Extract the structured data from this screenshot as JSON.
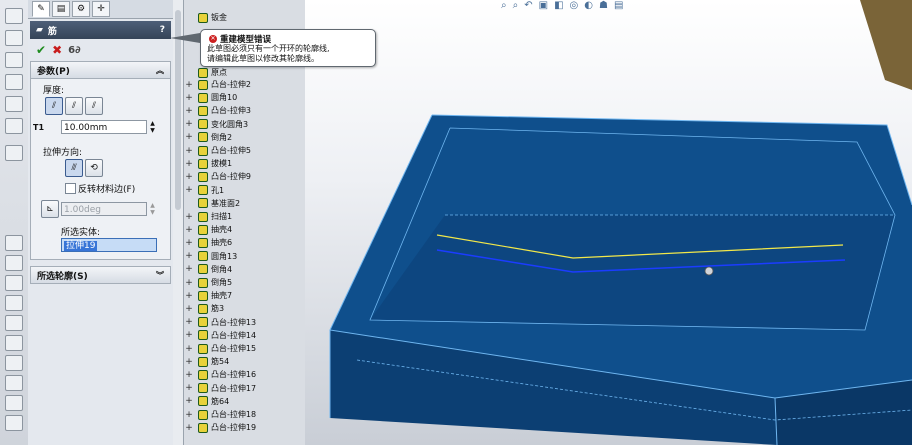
{
  "property_manager": {
    "title": "筋",
    "help": "?",
    "groups": {
      "params": {
        "label": "参数(P)"
      },
      "contours": {
        "label": "所选轮廓(S)"
      }
    },
    "thickness_label": "厚度:",
    "distance_value": "10.00mm",
    "extrude_dir_label": "拉伸方向:",
    "flip_material_label": "反转材料边(F)",
    "draft_value": "1.00deg",
    "selected_bodies_label": "所选实体:",
    "selected_body": "拉伸19",
    "distance_icon_label": "T1"
  },
  "error_tooltip": {
    "title": "重建模型错误",
    "line1": "此草图必须只有一个开环的轮廓线,",
    "line2": "请编辑此草图以修改其轮廓线。"
  },
  "tree": {
    "items": [
      {
        "label": "钣金",
        "expand": ""
      },
      {
        "label": "原点",
        "expand": ""
      },
      {
        "label": "凸台-拉伸2",
        "expand": "+"
      },
      {
        "label": "圆角10",
        "expand": "+"
      },
      {
        "label": "凸台-拉伸3",
        "expand": "+"
      },
      {
        "label": "变化圆角3",
        "expand": "+"
      },
      {
        "label": "倒角2",
        "expand": "+"
      },
      {
        "label": "凸台-拉伸5",
        "expand": "+"
      },
      {
        "label": "拔模1",
        "expand": "+"
      },
      {
        "label": "凸台-拉伸9",
        "expand": "+"
      },
      {
        "label": "孔1",
        "expand": "+"
      },
      {
        "label": "基准面2",
        "expand": ""
      },
      {
        "label": "扫描1",
        "expand": "+"
      },
      {
        "label": "抽壳4",
        "expand": "+"
      },
      {
        "label": "抽壳6",
        "expand": "+"
      },
      {
        "label": "圆角13",
        "expand": "+"
      },
      {
        "label": "倒角4",
        "expand": "+"
      },
      {
        "label": "倒角5",
        "expand": "+"
      },
      {
        "label": "抽壳7",
        "expand": "+"
      },
      {
        "label": "筋3",
        "expand": "+"
      },
      {
        "label": "凸台-拉伸13",
        "expand": "+"
      },
      {
        "label": "凸台-拉伸14",
        "expand": "+"
      },
      {
        "label": "凸台-拉伸15",
        "expand": "+"
      },
      {
        "label": "筋54",
        "expand": "+"
      },
      {
        "label": "凸台-拉伸16",
        "expand": "+"
      },
      {
        "label": "凸台-拉伸17",
        "expand": "+"
      },
      {
        "label": "筋64",
        "expand": "+"
      },
      {
        "label": "凸台-拉伸18",
        "expand": "+"
      },
      {
        "label": "凸台-拉伸19",
        "expand": "+"
      }
    ]
  },
  "colors": {
    "model": "#0f4f8c",
    "edges": "#6fb6f0",
    "sketch_yellow": "#f2e84a",
    "sketch_blue": "#1b3cff",
    "error_red": "#cc2020"
  }
}
